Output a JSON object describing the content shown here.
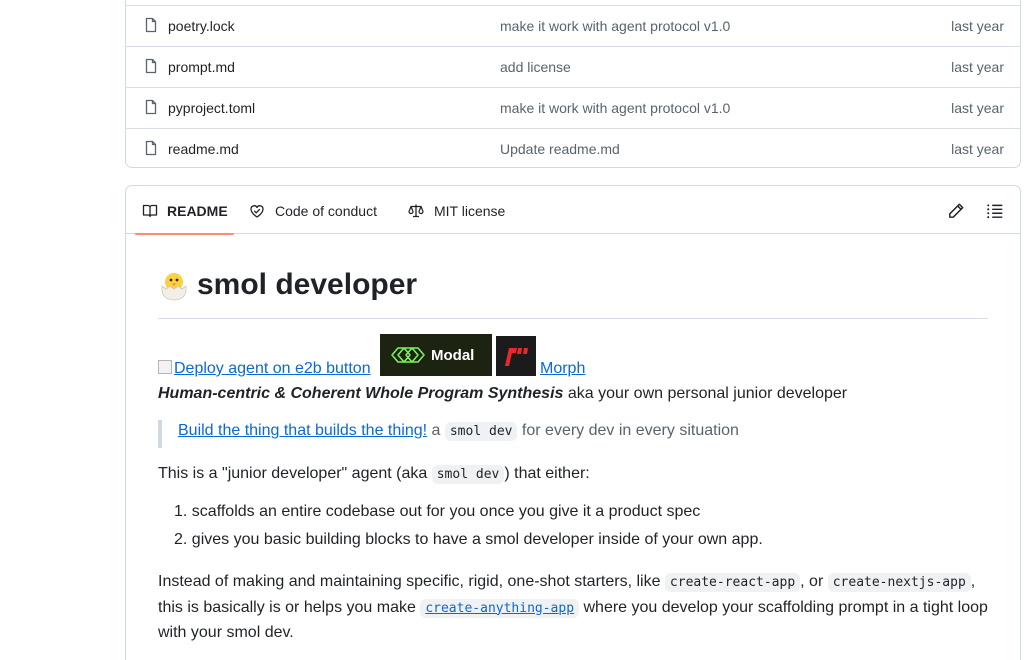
{
  "files": [
    {
      "name": "poetry.lock",
      "message": "make it work with agent protocol v1.0",
      "time": "last year"
    },
    {
      "name": "prompt.md",
      "message": "add license",
      "time": "last year"
    },
    {
      "name": "pyproject.toml",
      "message": "make it work with agent protocol v1.0",
      "time": "last year"
    },
    {
      "name": "readme.md",
      "message": "Update readme.md",
      "time": "last year"
    }
  ],
  "tabs": {
    "readme": "README",
    "code_of_conduct": "Code of conduct",
    "license": "MIT license"
  },
  "readme": {
    "title": "smol developer",
    "e2b_alt": "Deploy agent on e2b button",
    "modal_label": "Modal",
    "morph_label": "Morph",
    "subtitle_bold": "Human-centric & Coherent Whole Program Synthesis",
    "subtitle_rest": " aka your own personal junior developer",
    "quote_link": "Build the thing that builds the thing!",
    "quote_mid": " a ",
    "quote_code": "smol dev",
    "quote_end": " for every dev in every situation",
    "desc_start": "This is a \"junior developer\" agent (aka ",
    "desc_code": "smol dev",
    "desc_end": ") that either:",
    "list": [
      "1. scaffolds an entire codebase out for you once you give it a product spec",
      "2. gives you basic building blocks to have a smol developer inside of your own app."
    ],
    "para_1": "Instead of making and maintaining specific, rigid, one-shot starters, like ",
    "para_code_1": "create-react-app",
    "para_2": ", or ",
    "para_code_2": "create-nextjs-app",
    "para_3": ", this is basically is or helps you make ",
    "para_code_3": "create-anything-app",
    "para_4": " where you develop your scaffolding prompt in a tight loop with your smol dev."
  },
  "colors": {
    "link": "#0969da",
    "tab_underline": "#fd8c73",
    "modal_bg": "#1c2411",
    "modal_green": "#7fee64",
    "morph_red": "#e8282b"
  }
}
